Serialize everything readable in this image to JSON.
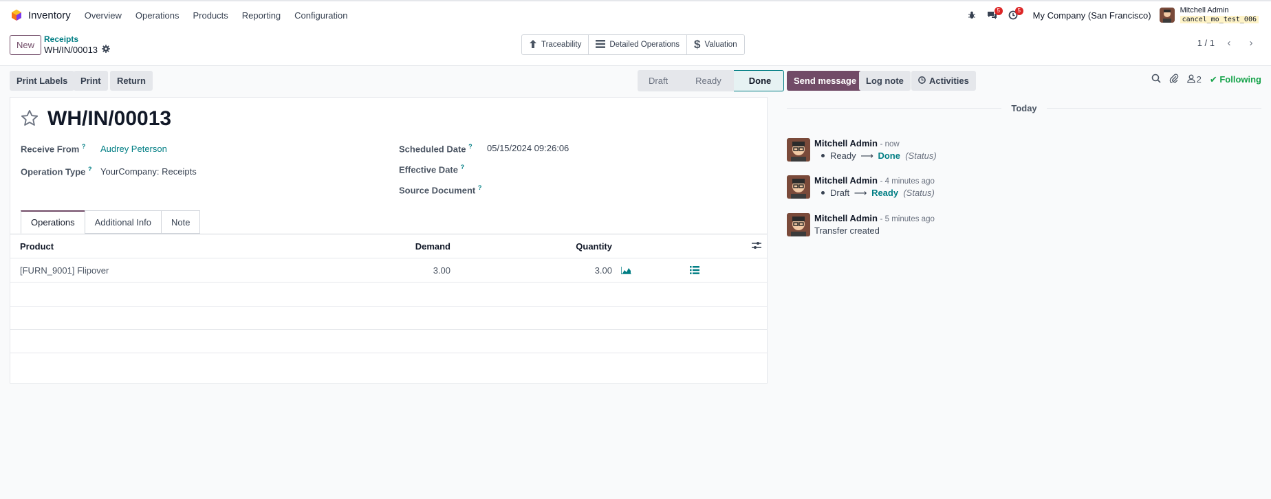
{
  "navbar": {
    "app_name": "Inventory",
    "menu": [
      "Overview",
      "Operations",
      "Products",
      "Reporting",
      "Configuration"
    ],
    "messages_badge": "5",
    "activities_badge": "5",
    "company": "My Company (San Francisco)",
    "user_name": "Mitchell Admin",
    "database": "cancel_mo_test_006"
  },
  "control": {
    "new_label": "New",
    "breadcrumb_parent": "Receipts",
    "breadcrumb_current": "WH/IN/00013",
    "smart_buttons": [
      "Traceability",
      "Detailed Operations",
      "Valuation"
    ],
    "pager": "1 / 1"
  },
  "actions": {
    "print_labels": "Print Labels",
    "print": "Print",
    "return": "Return"
  },
  "statusbar": [
    "Draft",
    "Ready",
    "Done"
  ],
  "form": {
    "title": "WH/IN/00013",
    "receive_from_label": "Receive From",
    "receive_from": "Audrey Peterson",
    "operation_type_label": "Operation Type",
    "operation_type": "YourCompany: Receipts",
    "scheduled_date_label": "Scheduled Date",
    "scheduled_date": "05/15/2024 09:26:06",
    "effective_date_label": "Effective Date",
    "source_document_label": "Source Document",
    "tabs": [
      "Operations",
      "Additional Info",
      "Note"
    ],
    "columns": {
      "product": "Product",
      "demand": "Demand",
      "quantity": "Quantity"
    },
    "lines": [
      {
        "product": "[FURN_9001] Flipover",
        "demand": "3.00",
        "quantity": "3.00"
      }
    ]
  },
  "chatter": {
    "send_message": "Send message",
    "log_note": "Log note",
    "activities": "Activities",
    "followers_count": "2",
    "following": "Following",
    "day_label": "Today",
    "messages": [
      {
        "author": "Mitchell Admin",
        "time": "- now",
        "old": "Ready",
        "new": "Done",
        "field": "(Status)"
      },
      {
        "author": "Mitchell Admin",
        "time": "- 4 minutes ago",
        "old": "Draft",
        "new": "Ready",
        "field": "(Status)"
      },
      {
        "author": "Mitchell Admin",
        "time": "- 5 minutes ago",
        "text": "Transfer created"
      }
    ]
  },
  "colors": {
    "brand": "#714b67",
    "link": "#017e84",
    "following": "#16a34a",
    "badge": "#dc2626"
  }
}
